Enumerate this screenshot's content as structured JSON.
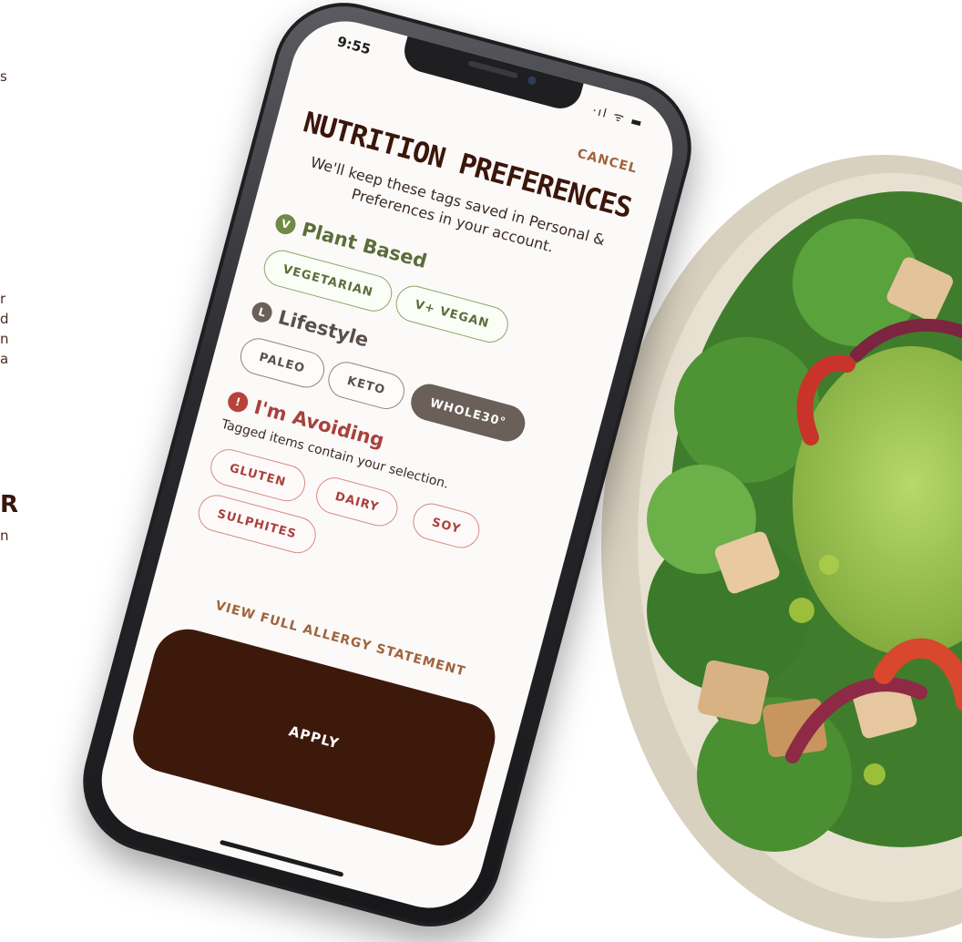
{
  "background_page": {
    "fragments": [
      "s",
      "r",
      "d",
      "n",
      "a",
      "R",
      "n"
    ]
  },
  "phone": {
    "status_bar": {
      "time": "9:55",
      "icons": "·ıl ᯤ ▬"
    },
    "cancel_label": "CANCEL",
    "title": "NUTRITION PREFERENCES",
    "subtitle": "We'll keep these tags saved in Personal & Preferences in your account.",
    "sections": {
      "plant_based": {
        "badge": "V",
        "label": "Plant Based",
        "chips": [
          "VEGETARIAN",
          "V+ VEGAN"
        ]
      },
      "lifestyle": {
        "badge": "L",
        "label": "Lifestyle",
        "chips": [
          "PALEO",
          "KETO",
          "WHOLE30°"
        ],
        "selected": "WHOLE30°"
      },
      "avoiding": {
        "badge": "!",
        "label": "I'm Avoiding",
        "hint": "Tagged items contain your selection.",
        "chips": [
          "GLUTEN",
          "DAIRY",
          "SOY",
          "SULPHITES"
        ]
      }
    },
    "allergy_link": "VIEW FULL ALLERGY STATEMENT",
    "apply_label": "APPLY"
  },
  "colors": {
    "brand_brown": "#3b160b",
    "accent_copper": "#a0643c",
    "plant_green": "#5c6d3b",
    "lifestyle_gray": "#6b5f59",
    "avoid_red": "#a8413c"
  }
}
